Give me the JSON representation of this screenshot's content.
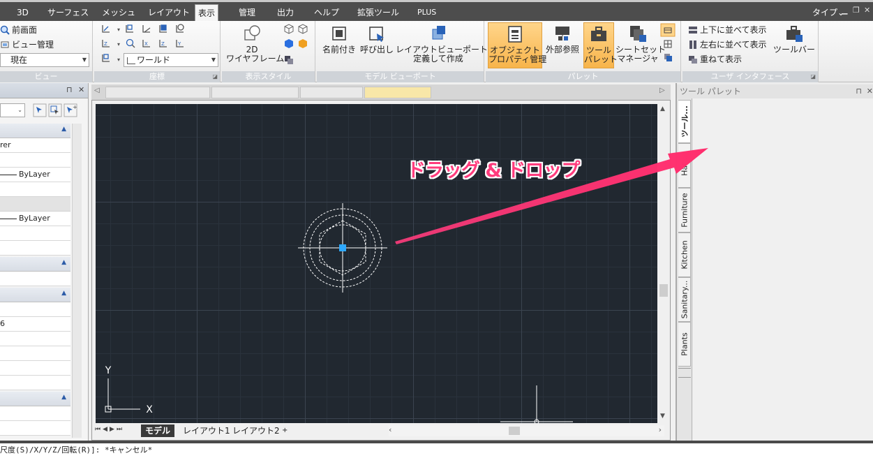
{
  "menu": {
    "tabs": [
      "3D",
      "サーフェス",
      "メッシュ",
      "レイアウト",
      "表示",
      "管理",
      "出力",
      "ヘルプ",
      "拡張ツール",
      "PLUS"
    ],
    "active_tab": "表示",
    "workspace": "タイプ"
  },
  "ribbon": {
    "view": {
      "title": "ビュー",
      "prev_view": "前画面",
      "view_manager": "ビュー管理",
      "current": "現在"
    },
    "coords": {
      "title": "座標",
      "ucs": "ワールド"
    },
    "display_style": {
      "title": "表示スタイル",
      "wireframe_line1": "2D",
      "wireframe_line2": "ワイヤフレーム"
    },
    "model_viewport": {
      "title": "モデル ビューポート",
      "named": "名前付き",
      "restore": "呼び出し",
      "create_line1": "レイアウトビューポートを",
      "create_line2": "定義して作成"
    },
    "palettes": {
      "title": "パレット",
      "obj_prop_line1": "オブジェクト",
      "obj_prop_line2": "プロパティ管理",
      "xref": "外部参照",
      "tool_palette_line1": "ツール",
      "tool_palette_line2": "パレット",
      "sheetset_line1": "シートセット",
      "sheetset_line2": "マネージャ"
    },
    "ui": {
      "title": "ユーザ インタフェース",
      "tile_h": "上下に並べて表示",
      "tile_v": "左右に並べて表示",
      "cascade": "重ねて表示",
      "toolbar": "ツールバー"
    }
  },
  "properties_panel": {
    "row1": "rer",
    "bylayer1": "ByLayer",
    "bylayer2": "ByLayer",
    "value_6": "6"
  },
  "layout_tabs": [
    "モデル",
    "レイアウト1",
    "レイアウト2",
    "+"
  ],
  "tool_palette": {
    "title": "ツール パレット",
    "tabs": [
      "ツール...",
      "Hat...",
      "Furniture",
      "Kitchen",
      "Sanitary...",
      "Plants"
    ]
  },
  "annotation": "ドラッグ & ドロップ",
  "axis": {
    "x": "X",
    "y": "Y"
  },
  "command_line": "尺度(S)/X/Y/Z/回転(R)]: *キャンセル*",
  "colors": {
    "canvas_bg": "#212830",
    "accent_arrow": "#ff3c7d",
    "selected_button": "#f7b44b"
  }
}
